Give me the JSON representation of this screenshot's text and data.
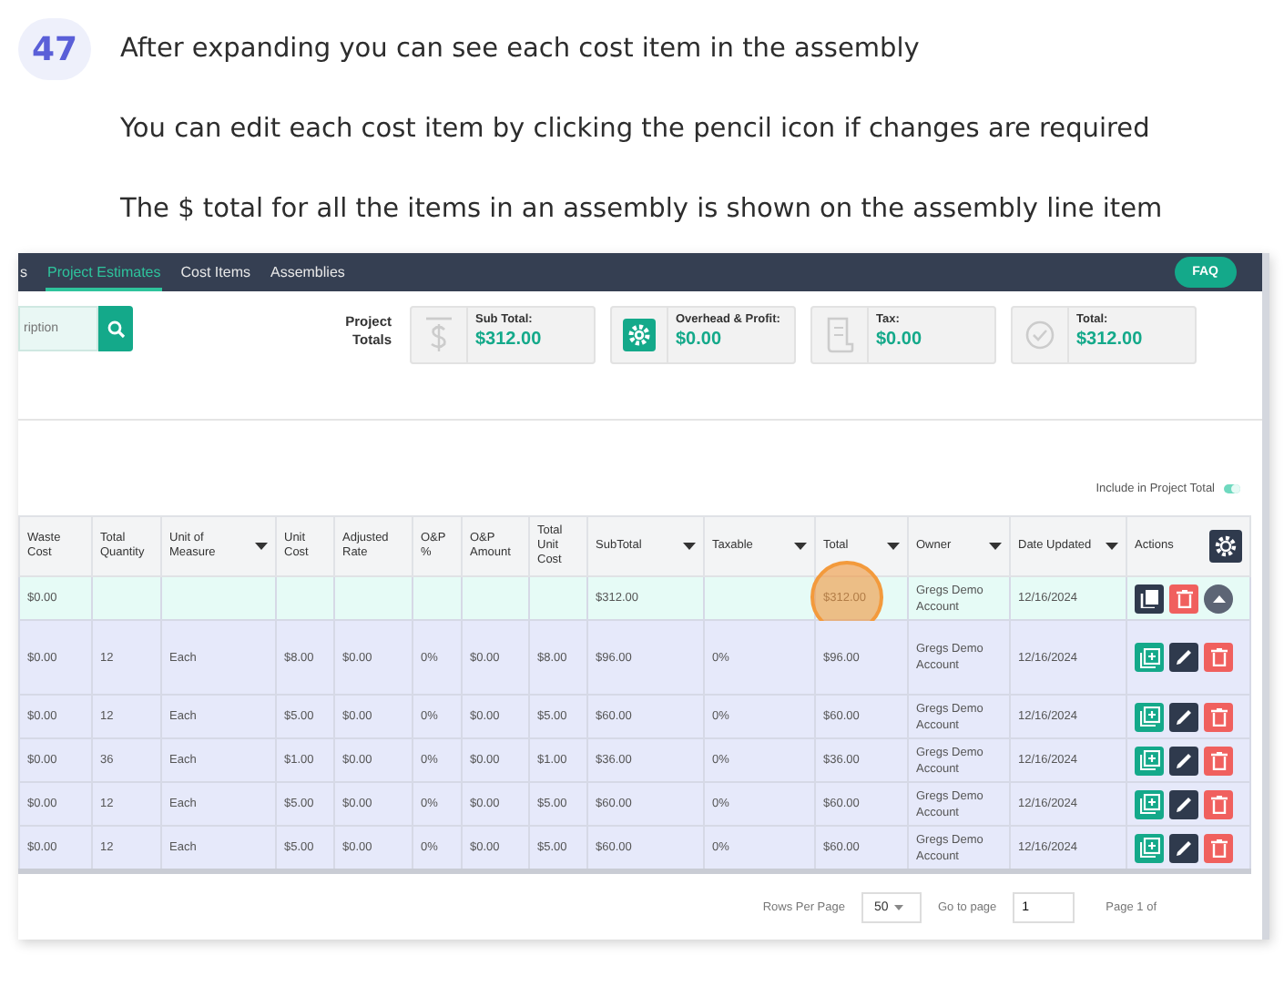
{
  "step": {
    "number": "47",
    "lines": [
      "After expanding you can see each cost item in the assembly",
      "You can edit each cost item by clicking the pencil icon if changes are required",
      "The $ total for all the items in an assembly is shown on the assembly line item"
    ]
  },
  "nav": {
    "tabs": [
      {
        "label": "s",
        "selected": false
      },
      {
        "label": "Project Estimates",
        "selected": true
      },
      {
        "label": "Cost Items",
        "selected": false
      },
      {
        "label": "Assemblies",
        "selected": false
      }
    ],
    "faq": "FAQ"
  },
  "search": {
    "placeholder": "ription"
  },
  "totals": {
    "label": "Project Totals",
    "cards": [
      {
        "kind": "dollar",
        "label": "Sub Total:",
        "value": "$312.00"
      },
      {
        "kind": "gear",
        "label": "Overhead & Profit:",
        "value": "$0.00"
      },
      {
        "kind": "receipt",
        "label": "Tax:",
        "value": "$0.00"
      },
      {
        "kind": "check",
        "label": "Total:",
        "value": "$312.00"
      }
    ]
  },
  "include_toggle": {
    "label": "Include in Project Total",
    "on": true
  },
  "table": {
    "columns": [
      {
        "label": "Waste Cost",
        "sortable": false
      },
      {
        "label": "Total Quantity",
        "sortable": false
      },
      {
        "label": "Unit of Measure",
        "sortable": true
      },
      {
        "label": "Unit Cost",
        "sortable": false
      },
      {
        "label": "Adjusted Rate",
        "sortable": false
      },
      {
        "label": "O&P %",
        "sortable": false
      },
      {
        "label": "O&P Amount",
        "sortable": false
      },
      {
        "label": "Total Unit Cost",
        "sortable": false
      },
      {
        "label": "SubTotal",
        "sortable": true
      },
      {
        "label": "Taxable",
        "sortable": true
      },
      {
        "label": "Total",
        "sortable": true
      },
      {
        "label": "Owner",
        "sortable": true
      },
      {
        "label": "Date Updated",
        "sortable": true
      },
      {
        "label": "Actions",
        "sortable": false
      }
    ],
    "rows": [
      {
        "kind": "assembly",
        "cells": [
          "$0.00",
          "",
          "",
          "",
          "",
          "",
          "",
          "",
          "$312.00",
          "",
          "$312.00",
          "Gregs Demo Account",
          "12/16/2024"
        ]
      },
      {
        "kind": "item",
        "cells": [
          "$0.00",
          "12",
          "Each",
          "$8.00",
          "$0.00",
          "0%",
          "$0.00",
          "$8.00",
          "$96.00",
          "0%",
          "$96.00",
          "Gregs Demo Account",
          "12/16/2024"
        ]
      },
      {
        "kind": "item",
        "cells": [
          "$0.00",
          "12",
          "Each",
          "$5.00",
          "$0.00",
          "0%",
          "$0.00",
          "$5.00",
          "$60.00",
          "0%",
          "$60.00",
          "Gregs Demo Account",
          "12/16/2024"
        ]
      },
      {
        "kind": "item",
        "cells": [
          "$0.00",
          "36",
          "Each",
          "$1.00",
          "$0.00",
          "0%",
          "$0.00",
          "$1.00",
          "$36.00",
          "0%",
          "$36.00",
          "Gregs Demo Account",
          "12/16/2024"
        ]
      },
      {
        "kind": "item",
        "cells": [
          "$0.00",
          "12",
          "Each",
          "$5.00",
          "$0.00",
          "0%",
          "$0.00",
          "$5.00",
          "$60.00",
          "0%",
          "$60.00",
          "Gregs Demo Account",
          "12/16/2024"
        ]
      },
      {
        "kind": "item",
        "cells": [
          "$0.00",
          "12",
          "Each",
          "$5.00",
          "$0.00",
          "0%",
          "$0.00",
          "$5.00",
          "$60.00",
          "0%",
          "$60.00",
          "Gregs Demo Account",
          "12/16/2024"
        ]
      }
    ]
  },
  "pagination": {
    "rows_label": "Rows Per Page",
    "rows_value": "50",
    "goto_label": "Go to page",
    "goto_value": "1",
    "page_text": "Page 1 of"
  }
}
